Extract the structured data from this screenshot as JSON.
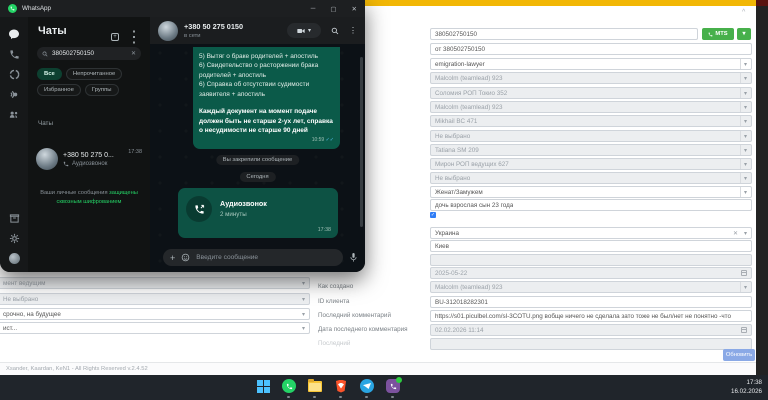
{
  "icons": {
    "minimize": "─",
    "maximize": "▢",
    "close": "✕",
    "kebab": "⋮",
    "caret": "▾",
    "plus": "+",
    "clear": "✕",
    "checks": "✓✓",
    "collapse": "^",
    "checkbox_check": "✓"
  },
  "whatsapp": {
    "title": "WhatsApp",
    "chats_panel": {
      "title": "Чаты",
      "search_value": "380502750150",
      "filters": {
        "all": "Все",
        "unread": "Непрочитанное",
        "favorites": "Избранное",
        "groups": "Группы"
      },
      "section_label": "Чаты",
      "chat_item": {
        "name": "+380 50 275 0...",
        "time": "17:38",
        "preview": "Аудиозвонок"
      },
      "encryption_prefix": "Ваши личные сообщения",
      "encryption_link": "защищены сквозным шифрованием"
    },
    "conversation": {
      "name": "+380 50 275 0150",
      "status": "в сети",
      "message": {
        "line1": "5) Вытяг о браке родителей + апостиль",
        "line2": "6) Свидетельство о расторжении брака родителей + апостиль",
        "line3": "6) Справка об отсутствии судимости заявителя + апостиль",
        "bold": "Каждый документ на момент подаче должен быть не старше 2-ух лет, справка о несудимости не старше 90 дней",
        "time": "10:59"
      },
      "system_pill": "Вы закрепили сообщение",
      "date_pill": "Сегодня",
      "call": {
        "title": "Аудиозвонок",
        "duration": "2 минуты",
        "time": "17:38"
      },
      "composer_placeholder": "Введите сообщение"
    }
  },
  "crm": {
    "call_button_label": "MTS",
    "update_button": "Обновить",
    "footer": "Xsander, Kaardan, KeN1 - All Rights Reserved v.2.4.52",
    "labels": [
      "Как создано",
      "ID клиента",
      "Последний комментарий",
      "Дата последнего комментария",
      "Последний"
    ],
    "left_fragments": [
      "мент ведущим",
      "Не выбрано",
      "срочно, на будущее",
      "ист..."
    ],
    "fields": [
      {
        "value": "380502750150"
      },
      {
        "value": "от 380502750150"
      },
      {
        "value": "emigration-lawyer"
      },
      {
        "value": "Malcolm (teamlead) 923"
      },
      {
        "value": "Соломия РОП Токио 352"
      },
      {
        "value": "Malcolm (teamlead) 923"
      },
      {
        "value": "Mikhail BC 471"
      },
      {
        "value": "Не выбрано"
      },
      {
        "value": "Tatiana SM 209"
      },
      {
        "value": "Мирон РОП ведущих 627"
      },
      {
        "value": "Не выбрано"
      },
      {
        "value": "Женат/Замужем"
      },
      {
        "value": "дочь взрослая сын 23 года"
      },
      {
        "value": "",
        "checked": true
      },
      {
        "value": "Украина"
      },
      {
        "value": "Киев"
      },
      {
        "value": ""
      },
      {
        "value": "2025-05-22"
      },
      {
        "value": "Malcolm (teamlead) 923"
      },
      {
        "value": "BU-312018282301"
      },
      {
        "value": "https://s01.piculbel.com/sl-3COTU.png вобще ничего не сделала зато тоже не был/нет не понятно -что"
      },
      {
        "value": "02.02.2026 11:14"
      },
      {
        "value": ""
      }
    ]
  },
  "taskbar": {
    "time": "17:38",
    "date": "16.02.2026",
    "apps": [
      "start",
      "whatsapp",
      "explorer",
      "brave",
      "telegram",
      "viber"
    ]
  }
}
